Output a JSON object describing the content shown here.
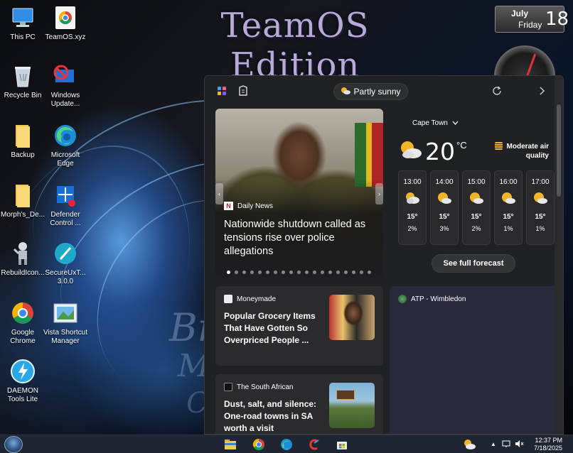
{
  "wallpaper": {
    "title": "TeamOS Edition",
    "script_text_1": "Br",
    "script_text_2": "M",
    "script_text_3": "C"
  },
  "date_gadget": {
    "month": "July",
    "weekday": "Friday",
    "day": "18"
  },
  "desktop_icons": [
    {
      "label": "This PC",
      "icon": "computer-icon"
    },
    {
      "label": "TeamOS.xyz",
      "icon": "chrome-icon"
    },
    {
      "label": "Recycle Bin",
      "icon": "recycle-bin-icon"
    },
    {
      "label": "Windows Update...",
      "icon": "windows-update-icon"
    },
    {
      "label": "Backup",
      "icon": "folder-icon"
    },
    {
      "label": "Microsoft Edge",
      "icon": "edge-icon"
    },
    {
      "label": "Morph's_De...",
      "icon": "folder-icon"
    },
    {
      "label": "Defender Control ...",
      "icon": "defender-icon"
    },
    {
      "label": "RebuildIcon...",
      "icon": "robot-icon"
    },
    {
      "label": "SecureUxT... 3.0.0",
      "icon": "brush-icon"
    },
    {
      "label": "Google Chrome",
      "icon": "chrome-icon"
    },
    {
      "label": "Vista Shortcut Manager",
      "icon": "shortcut-manager-icon"
    },
    {
      "label": "DAEMON Tools Lite",
      "icon": "daemon-tools-icon"
    }
  ],
  "widgets": {
    "weather_pill": "Partly sunny",
    "hero": {
      "source": "Daily News",
      "title": "Nationwide shutdown called as tensions rise over police allegations",
      "dot_count": 19,
      "active_dot": 0
    },
    "weather": {
      "city": "Cape Town",
      "temperature": "20",
      "unit": "°C",
      "air_quality": "Moderate air quality",
      "hourly": [
        {
          "time": "13:00",
          "temp": "15°",
          "precip": "2%",
          "icon": "partly-cloudy-icon"
        },
        {
          "time": "14:00",
          "temp": "15°",
          "precip": "3%",
          "icon": "partly-sunny-icon"
        },
        {
          "time": "15:00",
          "temp": "15°",
          "precip": "2%",
          "icon": "partly-sunny-icon"
        },
        {
          "time": "16:00",
          "temp": "15°",
          "precip": "1%",
          "icon": "partly-sunny-icon"
        },
        {
          "time": "17:00",
          "temp": "15°",
          "precip": "1%",
          "icon": "partly-sunny-icon"
        }
      ],
      "forecast_button": "See full forecast"
    },
    "news": [
      {
        "source": "Moneymade",
        "title": "Popular Grocery Items That Have Gotten So Overpriced People ..."
      },
      {
        "source": "The South African",
        "title": "Dust, salt, and silence: One-road towns in SA worth a visit"
      }
    ],
    "atp": {
      "title": "ATP - Wimbledon"
    }
  },
  "taskbar": {
    "time": "12:37 PM",
    "date": "7/18/2025",
    "apps": [
      "file-explorer-icon",
      "chrome-icon",
      "edge-icon",
      "ccleaner-icon",
      "store-icon"
    ]
  },
  "colors": {
    "panel_bg": "#202124",
    "card_bg": "#2b2b2e",
    "taskbar_bg": "#1f2631",
    "accent_sun": "#f0b429"
  }
}
